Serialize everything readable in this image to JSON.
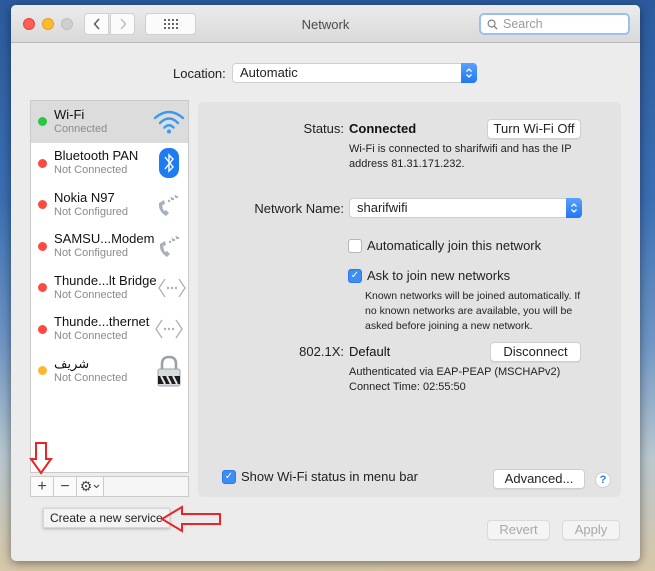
{
  "window": {
    "title": "Network",
    "search_placeholder": "Search"
  },
  "toolbar": {
    "back_icon": "chevron-left-icon",
    "forward_icon": "chevron-right-icon",
    "show_all_icon": "grid-icon"
  },
  "location": {
    "label": "Location:",
    "value": "Automatic"
  },
  "services": [
    {
      "name": "Wi-Fi",
      "state": "Connected",
      "status_color": "#28c840",
      "icon": "wifi-icon",
      "selected": true
    },
    {
      "name": "Bluetooth PAN",
      "state": "Not Connected",
      "status_color": "#fc4a42",
      "icon": "bluetooth-icon"
    },
    {
      "name": "Nokia N97",
      "state": "Not Configured",
      "status_color": "#fc4a42",
      "icon": "phone-modem-icon"
    },
    {
      "name": "SAMSU...Modem",
      "state": "Not Configured",
      "status_color": "#fc4a42",
      "icon": "phone-modem-icon"
    },
    {
      "name": "Thunde...lt Bridge",
      "state": "Not Connected",
      "status_color": "#fc4a42",
      "icon": "ethernet-icon"
    },
    {
      "name": "Thunde...thernet",
      "state": "Not Connected",
      "status_color": "#fc4a42",
      "icon": "ethernet-icon"
    },
    {
      "name": "شريف",
      "state": "Not Connected",
      "status_color": "#fdb92d",
      "icon": "vpn-lock-icon"
    }
  ],
  "sidebar_tools": {
    "add": "+",
    "remove": "−",
    "action": "⚙"
  },
  "tooltip": "Create a new service",
  "detail": {
    "status_label": "Status:",
    "status_value": "Connected",
    "turn_off_button": "Turn Wi-Fi Off",
    "status_description_line1": "Wi-Fi is connected to sharifwifi and has the IP",
    "status_description_line2": "address 81.31.171.232.",
    "network_name_label": "Network Name:",
    "network_name_value": "sharifwifi",
    "auto_join_label": "Automatically join this network",
    "auto_join_checked": false,
    "ask_join_label": "Ask to join new networks",
    "ask_join_checked": true,
    "ask_join_help_line1": "Known networks will be joined automatically. If",
    "ask_join_help_line2": "no known networks are available, you will be",
    "ask_join_help_line3": "asked before joining a new network.",
    "dot1x_label": "802.1X:",
    "dot1x_value": "Default",
    "disconnect_button": "Disconnect",
    "auth_line": "Authenticated via EAP-PEAP (MSCHAPv2)",
    "connect_time": "Connect Time: 02:55:50",
    "show_status_label": "Show Wi-Fi status in menu bar",
    "show_status_checked": true,
    "advanced_button": "Advanced...",
    "help_button": "?"
  },
  "footer": {
    "revert_button": "Revert",
    "apply_button": "Apply"
  },
  "annotations": {
    "arrow_color": "#e8262a"
  }
}
